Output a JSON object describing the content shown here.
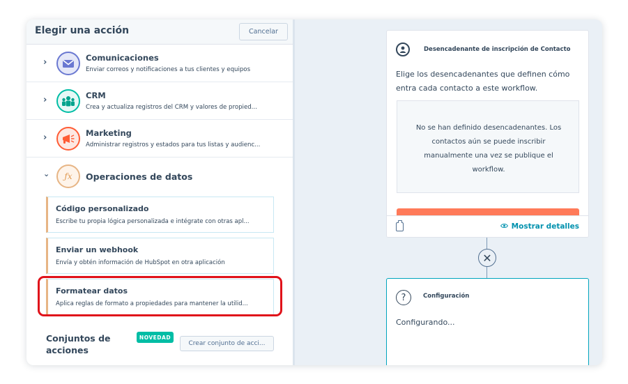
{
  "left_panel": {
    "title": "Elegir una acción",
    "cancel_label": "Cancelar",
    "categories": [
      {
        "title": "Comunicaciones",
        "desc": "Enviar correos y notificaciones a tus clientes y equipos",
        "icon": "envelope-icon",
        "color": "#6a78d1"
      },
      {
        "title": "CRM",
        "desc": "Crea y actualiza registros del CRM y valores de propied...",
        "icon": "people-icon",
        "color": "#00bda5"
      },
      {
        "title": "Marketing",
        "desc": "Administrar registros y estados para tus listas y audienc...",
        "icon": "megaphone-icon",
        "color": "#ff5c35"
      },
      {
        "title": "Operaciones de datos",
        "icon": "function-icon",
        "color": "#e7b585"
      }
    ],
    "data_ops_items": [
      {
        "title": "Código personalizado",
        "desc": "Escribe tu propia lógica personalizada e intégrate con otras apl..."
      },
      {
        "title": "Enviar un webhook",
        "desc": "Envía y obtén información de HubSpot en otra aplicación"
      },
      {
        "title": "Formatear datos",
        "desc": "Aplica reglas de formato a propiedades para mantener la utilid..."
      }
    ],
    "action_sets": {
      "title": "Conjuntos de acciones",
      "badge": "NOVEDAD",
      "create_label": "Crear conjunto de acci..."
    }
  },
  "trigger_card": {
    "title": "Desencadenante de inscripción de Contacto",
    "desc": "Elige los desencadenantes que definen cómo entra cada contacto a este workflow.",
    "empty_text": "No se han definido desencadenantes. Los contactos aún se puede inscribir manualmente una vez se publique el workflow.",
    "show_details": "Mostrar detalles"
  },
  "config_card": {
    "title": "Configuración",
    "status": "Configurando..."
  },
  "colors": {
    "accent": "#0091ae",
    "highlight": "#e0121a",
    "orange": "#ff7a59",
    "badge": "#00bda5"
  }
}
